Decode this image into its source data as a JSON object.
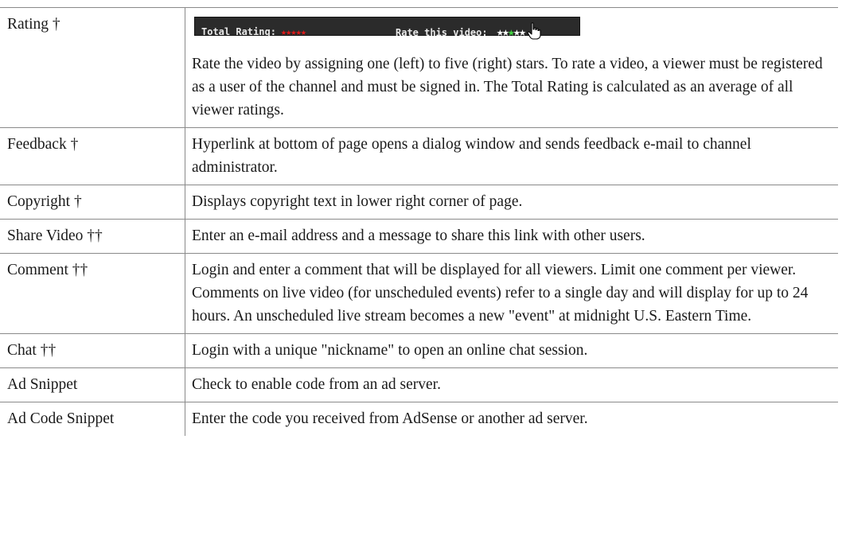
{
  "rows": [
    {
      "term": "Rating †",
      "widget": {
        "total_label": "Total Rating:",
        "total_stars": "★★★★★",
        "rate_label": "Rate this video:",
        "rate_stars_before": "★★",
        "rate_star_hot": "★",
        "rate_stars_after": "★★",
        "total_star_color": "#e01818",
        "hover_star_color": "#3fd13f",
        "cursor_icon": "hand-pointer-icon"
      },
      "desc": "Rate the video by assigning one (left) to five (right) stars. To rate a video, a viewer must be registered as a user of the channel and must be signed in. The Total Rating is calculated as an average of all viewer ratings."
    },
    {
      "term": "Feedback †",
      "desc": "Hyperlink at bottom of page opens a dialog window and sends feedback e-mail to channel administrator."
    },
    {
      "term": "Copyright †",
      "desc": "Displays copyright text in lower right corner of page."
    },
    {
      "term": "Share Video ††",
      "desc": "Enter an e-mail address and a message to share this link with other users."
    },
    {
      "term": "Comment ††",
      "desc": "Login and enter a comment that will be displayed for all viewers. Limit one comment per viewer. Comments on live video (for unscheduled events) refer to a single day and will display for up to 24 hours. An unscheduled live stream becomes a new \"event\" at midnight U.S. Eastern Time."
    },
    {
      "term": "Chat ††",
      "desc": "Login with a unique \"nickname\" to open an online chat session."
    },
    {
      "term": "Ad Snippet",
      "desc": "Check to enable code from an ad server."
    },
    {
      "term": "Ad Code Snippet",
      "desc": "Enter the code you received from AdSense or another ad server."
    }
  ]
}
